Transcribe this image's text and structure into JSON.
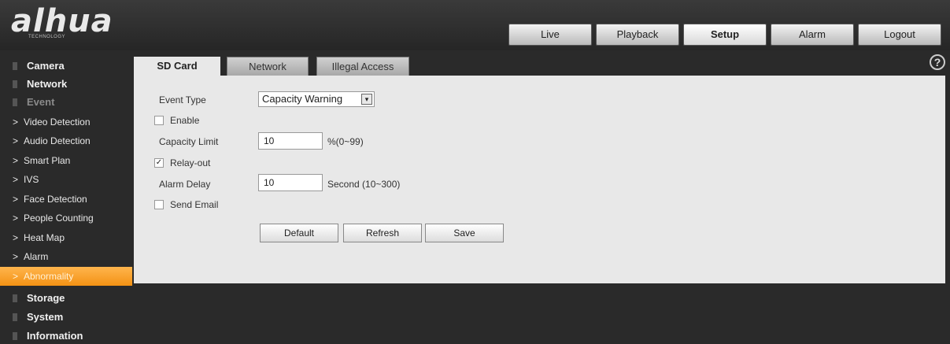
{
  "header": {
    "logo_text": "alhua",
    "logo_sub": "TECHNOLOGY",
    "nav": [
      "Live",
      "Playback",
      "Setup",
      "Alarm",
      "Logout"
    ]
  },
  "sidebar": {
    "sections": [
      "Camera",
      "Network",
      "Event",
      "Storage",
      "System",
      "Information"
    ],
    "event_items": [
      "Video Detection",
      "Audio Detection",
      "Smart Plan",
      "IVS",
      "Face Detection",
      "People Counting",
      "Heat Map",
      "Alarm",
      "Abnormality"
    ]
  },
  "tabs": [
    "SD Card",
    "Network",
    "Illegal Access"
  ],
  "form": {
    "event_type_label": "Event Type",
    "event_type_value": "Capacity Warning",
    "enable_label": "Enable",
    "capacity_label": "Capacity Limit",
    "capacity_value": "10",
    "capacity_unit": "%(0~99)",
    "relay_label": "Relay-out",
    "alarm_delay_label": "Alarm Delay",
    "alarm_delay_value": "10",
    "alarm_delay_unit": "Second (10~300)",
    "send_email_label": "Send Email",
    "enable_checked": false,
    "relay_checked": true,
    "send_email_checked": false
  },
  "buttons": {
    "default": "Default",
    "refresh": "Refresh",
    "save": "Save"
  },
  "help_icon": "?",
  "icons": {
    "checkmark": "✓",
    "dropdown": "▾",
    "chevron": ">"
  }
}
